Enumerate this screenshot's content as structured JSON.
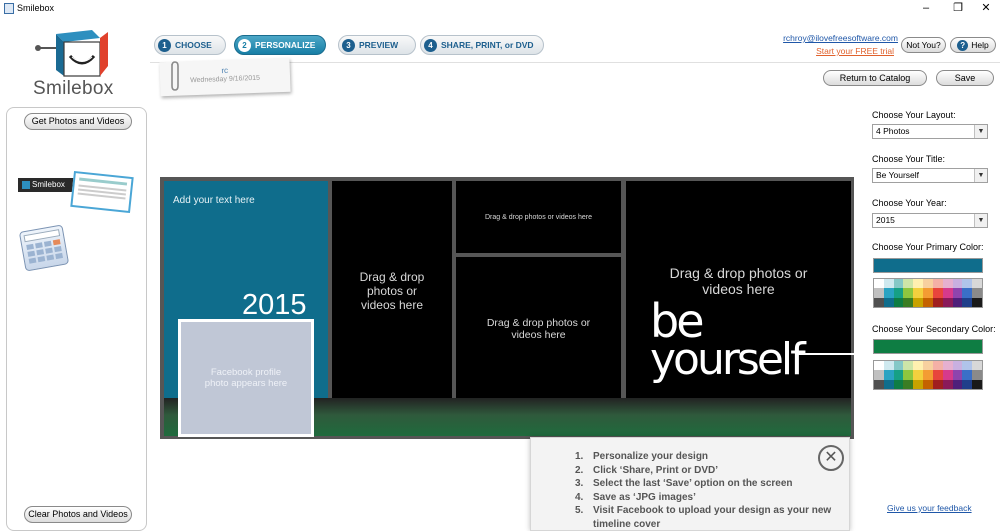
{
  "window": {
    "title": "Smilebox",
    "controls": [
      "–",
      "❐",
      "✕"
    ]
  },
  "brand": {
    "logo_text": "Smilebox"
  },
  "steps": [
    {
      "num": "1",
      "label": "CHOOSE",
      "active": false
    },
    {
      "num": "2",
      "label": "PERSONALIZE",
      "active": true
    },
    {
      "num": "3",
      "label": "PREVIEW",
      "active": false
    },
    {
      "num": "4",
      "label": "SHARE, PRINT, or DVD",
      "active": false
    }
  ],
  "account": {
    "email": "rchroy@ilovefreesoftware.com",
    "trial_link": "Start your FREE trial",
    "not_you": "Not You?",
    "help": "Help"
  },
  "project_tag": {
    "name": "rc",
    "date": "Wednesday 9/16/2015"
  },
  "toolbar": {
    "return_label": "Return to Catalog",
    "save_label": "Save"
  },
  "left_panel": {
    "get_photos": "Get Photos and Videos",
    "clear_photos": "Clear Photos and Videos",
    "thumb1_text": "Smilebox"
  },
  "settings": {
    "layout_label": "Choose Your Layout:",
    "layout_value": "4 Photos",
    "title_label": "Choose Your Title:",
    "title_value": "Be Yourself",
    "year_label": "Choose Your Year:",
    "year_value": "2015",
    "primary_label": "Choose Your Primary Color:",
    "primary_color": "#0f6d8c",
    "secondary_label": "Choose Your Secondary Color:",
    "secondary_color": "#0e7d43"
  },
  "design": {
    "add_text": "Add your text here",
    "year": "2015",
    "fb_profile": "Facebook profile photo appears here",
    "drop_tile2": "Drag & drop photos or videos here",
    "drop_tile3": "Drag & drop photos or videos here",
    "drop_tile4": "Drag & drop photos or videos here",
    "drop_tile5": "Drag & drop photos or videos here",
    "title_line1": "be",
    "title_line2": "yourself"
  },
  "instructions": {
    "items": [
      {
        "n": "1.",
        "t": "Personalize your design"
      },
      {
        "n": "2.",
        "t": "Click ‘Share, Print or DVD’"
      },
      {
        "n": "3.",
        "t": "Select the last ‘Save’ option on the screen"
      },
      {
        "n": "4.",
        "t": "Save as ‘JPG images’"
      },
      {
        "n": "5.",
        "t": "Visit Facebook to upload your design as your new timeline cover"
      }
    ]
  },
  "feedback": {
    "label": "Give us your feedback"
  },
  "palette_colors": [
    "#ffffff",
    "#cfe9ef",
    "#84c8c7",
    "#cde5a8",
    "#fff0b0",
    "#f7d09f",
    "#f4b0a6",
    "#e6b0d0",
    "#c9b0e0",
    "#b0c4ea",
    "#d8d8d8",
    "#c0c0c0",
    "#2aa3c2",
    "#16a085",
    "#8dc63f",
    "#f3d03e",
    "#f39c33",
    "#e8453c",
    "#d63a8c",
    "#8e44ad",
    "#3a6fc7",
    "#8a8a8a",
    "#505050",
    "#0f6d8c",
    "#0e7d43",
    "#3b7d23",
    "#c8a200",
    "#c46200",
    "#a01f1f",
    "#8a1a5a",
    "#4e1f7a",
    "#1f3f8a",
    "#1a1a1a"
  ]
}
